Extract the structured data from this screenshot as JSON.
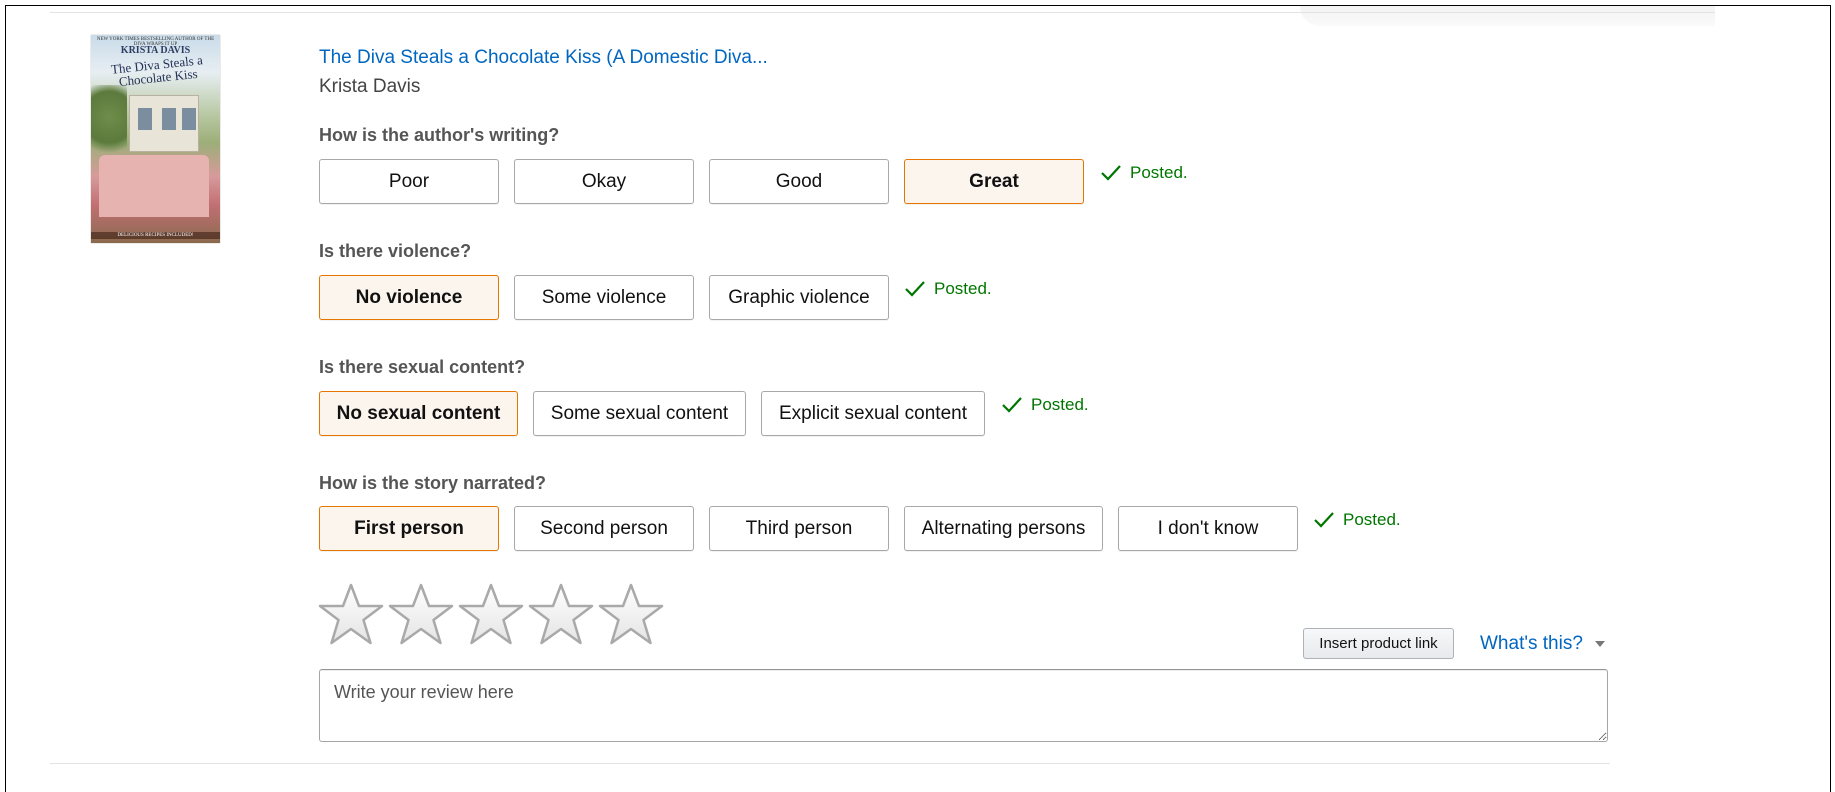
{
  "book": {
    "title": "The Diva Steals a Chocolate Kiss (A Domestic Diva...",
    "author": "Krista Davis",
    "cover": {
      "top_line": "NEW YORK TIMES BESTSELLING AUTHOR OF THE DIVA WRAPS IT UP",
      "author": "KRISTA DAVIS",
      "title": "The Diva Steals a Chocolate Kiss",
      "footer": "DELICIOUS RECIPES INCLUDED!"
    }
  },
  "questions": [
    {
      "label": "How is the author's writing?",
      "options": [
        "Poor",
        "Okay",
        "Good",
        "Great"
      ],
      "selected": "Great",
      "status": "Posted."
    },
    {
      "label": "Is there violence?",
      "options": [
        "No violence",
        "Some violence",
        "Graphic violence"
      ],
      "selected": "No violence",
      "status": "Posted."
    },
    {
      "label": "Is there sexual content?",
      "options": [
        "No sexual content",
        "Some sexual content",
        "Explicit sexual content"
      ],
      "selected": "No sexual content",
      "status": "Posted."
    },
    {
      "label": "How is the story narrated?",
      "options": [
        "First person",
        "Second person",
        "Third person",
        "Alternating persons",
        "I don't know"
      ],
      "selected": "First person",
      "status": "Posted."
    }
  ],
  "rating": {
    "stars_total": 5,
    "stars_filled": 0
  },
  "review": {
    "insert_link_label": "Insert product link",
    "whats_this_label": "What's this?",
    "placeholder": "Write your review here",
    "value": ""
  },
  "colors": {
    "link": "#0066c0",
    "selected_border": "#e77600",
    "selected_bg": "#fcf5ee",
    "posted": "#007600"
  },
  "icons": {
    "posted": "checkmark-icon",
    "star": "empty-star-icon",
    "dropdown": "caret-down-icon"
  }
}
